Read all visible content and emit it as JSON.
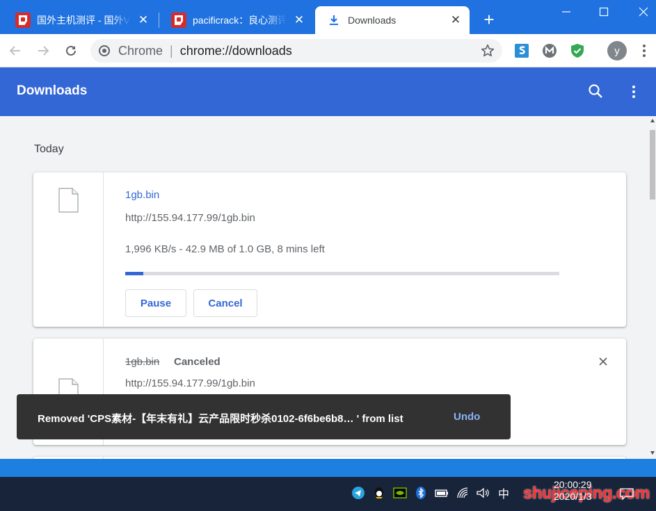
{
  "tabs": [
    {
      "title": "国外主机测评 - 国外VPS，",
      "close": "✕",
      "active": false
    },
    {
      "title": "pacificrack：良心测评",
      "close": "✕",
      "active": false
    },
    {
      "title": "Downloads",
      "close": "✕",
      "active": true
    }
  ],
  "newtab_label": "+",
  "omnibox": {
    "scheme": "Chrome",
    "divider": "|",
    "url": "chrome://downloads"
  },
  "avatar_letter": "y",
  "page": {
    "title": "Downloads"
  },
  "date_heading": "Today",
  "downloads": [
    {
      "name": "1gb.bin",
      "url": "http://155.94.177.99/1gb.bin",
      "status": "1,996 KB/s - 42.9 MB of 1.0 GB, 8 mins left",
      "progress": 0.042,
      "actions": {
        "pause": "Pause",
        "cancel": "Cancel"
      }
    },
    {
      "name": "1gb.bin",
      "state": "Canceled",
      "url": "http://155.94.177.99/1gb.bin"
    }
  ],
  "toast": {
    "message": "Removed 'CPS素材-【年末有礼】云产品限时秒杀0102-6f6be6b8…  ' from list",
    "undo": "Undo"
  },
  "taskbar": {
    "ime": "中",
    "time": "20:00:29",
    "date": "2020/1/3",
    "watermark": "shujiceping.com"
  },
  "colors": {
    "tabstrip": "#1f72e0",
    "header": "#3367d6",
    "accent": "#3367d6",
    "toast": "#323232",
    "undo": "#8ab4f8"
  }
}
